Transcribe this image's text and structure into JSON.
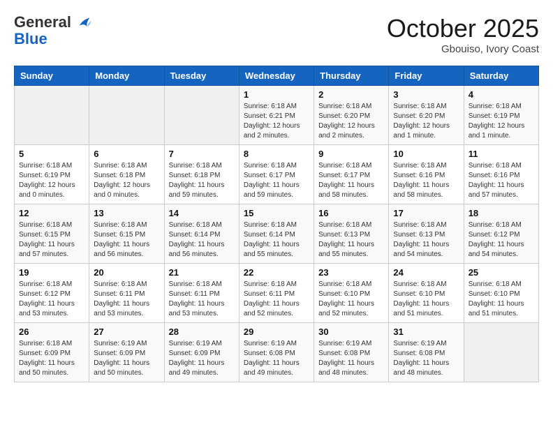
{
  "header": {
    "logo_line1": "General",
    "logo_line2": "Blue",
    "month": "October 2025",
    "location": "Gbouiso, Ivory Coast"
  },
  "days_of_week": [
    "Sunday",
    "Monday",
    "Tuesday",
    "Wednesday",
    "Thursday",
    "Friday",
    "Saturday"
  ],
  "weeks": [
    [
      {
        "num": "",
        "info": ""
      },
      {
        "num": "",
        "info": ""
      },
      {
        "num": "",
        "info": ""
      },
      {
        "num": "1",
        "info": "Sunrise: 6:18 AM\nSunset: 6:21 PM\nDaylight: 12 hours\nand 2 minutes."
      },
      {
        "num": "2",
        "info": "Sunrise: 6:18 AM\nSunset: 6:20 PM\nDaylight: 12 hours\nand 2 minutes."
      },
      {
        "num": "3",
        "info": "Sunrise: 6:18 AM\nSunset: 6:20 PM\nDaylight: 12 hours\nand 1 minute."
      },
      {
        "num": "4",
        "info": "Sunrise: 6:18 AM\nSunset: 6:19 PM\nDaylight: 12 hours\nand 1 minute."
      }
    ],
    [
      {
        "num": "5",
        "info": "Sunrise: 6:18 AM\nSunset: 6:19 PM\nDaylight: 12 hours\nand 0 minutes."
      },
      {
        "num": "6",
        "info": "Sunrise: 6:18 AM\nSunset: 6:18 PM\nDaylight: 12 hours\nand 0 minutes."
      },
      {
        "num": "7",
        "info": "Sunrise: 6:18 AM\nSunset: 6:18 PM\nDaylight: 11 hours\nand 59 minutes."
      },
      {
        "num": "8",
        "info": "Sunrise: 6:18 AM\nSunset: 6:17 PM\nDaylight: 11 hours\nand 59 minutes."
      },
      {
        "num": "9",
        "info": "Sunrise: 6:18 AM\nSunset: 6:17 PM\nDaylight: 11 hours\nand 58 minutes."
      },
      {
        "num": "10",
        "info": "Sunrise: 6:18 AM\nSunset: 6:16 PM\nDaylight: 11 hours\nand 58 minutes."
      },
      {
        "num": "11",
        "info": "Sunrise: 6:18 AM\nSunset: 6:16 PM\nDaylight: 11 hours\nand 57 minutes."
      }
    ],
    [
      {
        "num": "12",
        "info": "Sunrise: 6:18 AM\nSunset: 6:15 PM\nDaylight: 11 hours\nand 57 minutes."
      },
      {
        "num": "13",
        "info": "Sunrise: 6:18 AM\nSunset: 6:15 PM\nDaylight: 11 hours\nand 56 minutes."
      },
      {
        "num": "14",
        "info": "Sunrise: 6:18 AM\nSunset: 6:14 PM\nDaylight: 11 hours\nand 56 minutes."
      },
      {
        "num": "15",
        "info": "Sunrise: 6:18 AM\nSunset: 6:14 PM\nDaylight: 11 hours\nand 55 minutes."
      },
      {
        "num": "16",
        "info": "Sunrise: 6:18 AM\nSunset: 6:13 PM\nDaylight: 11 hours\nand 55 minutes."
      },
      {
        "num": "17",
        "info": "Sunrise: 6:18 AM\nSunset: 6:13 PM\nDaylight: 11 hours\nand 54 minutes."
      },
      {
        "num": "18",
        "info": "Sunrise: 6:18 AM\nSunset: 6:12 PM\nDaylight: 11 hours\nand 54 minutes."
      }
    ],
    [
      {
        "num": "19",
        "info": "Sunrise: 6:18 AM\nSunset: 6:12 PM\nDaylight: 11 hours\nand 53 minutes."
      },
      {
        "num": "20",
        "info": "Sunrise: 6:18 AM\nSunset: 6:11 PM\nDaylight: 11 hours\nand 53 minutes."
      },
      {
        "num": "21",
        "info": "Sunrise: 6:18 AM\nSunset: 6:11 PM\nDaylight: 11 hours\nand 53 minutes."
      },
      {
        "num": "22",
        "info": "Sunrise: 6:18 AM\nSunset: 6:11 PM\nDaylight: 11 hours\nand 52 minutes."
      },
      {
        "num": "23",
        "info": "Sunrise: 6:18 AM\nSunset: 6:10 PM\nDaylight: 11 hours\nand 52 minutes."
      },
      {
        "num": "24",
        "info": "Sunrise: 6:18 AM\nSunset: 6:10 PM\nDaylight: 11 hours\nand 51 minutes."
      },
      {
        "num": "25",
        "info": "Sunrise: 6:18 AM\nSunset: 6:10 PM\nDaylight: 11 hours\nand 51 minutes."
      }
    ],
    [
      {
        "num": "26",
        "info": "Sunrise: 6:18 AM\nSunset: 6:09 PM\nDaylight: 11 hours\nand 50 minutes."
      },
      {
        "num": "27",
        "info": "Sunrise: 6:19 AM\nSunset: 6:09 PM\nDaylight: 11 hours\nand 50 minutes."
      },
      {
        "num": "28",
        "info": "Sunrise: 6:19 AM\nSunset: 6:09 PM\nDaylight: 11 hours\nand 49 minutes."
      },
      {
        "num": "29",
        "info": "Sunrise: 6:19 AM\nSunset: 6:08 PM\nDaylight: 11 hours\nand 49 minutes."
      },
      {
        "num": "30",
        "info": "Sunrise: 6:19 AM\nSunset: 6:08 PM\nDaylight: 11 hours\nand 48 minutes."
      },
      {
        "num": "31",
        "info": "Sunrise: 6:19 AM\nSunset: 6:08 PM\nDaylight: 11 hours\nand 48 minutes."
      },
      {
        "num": "",
        "info": ""
      }
    ]
  ]
}
